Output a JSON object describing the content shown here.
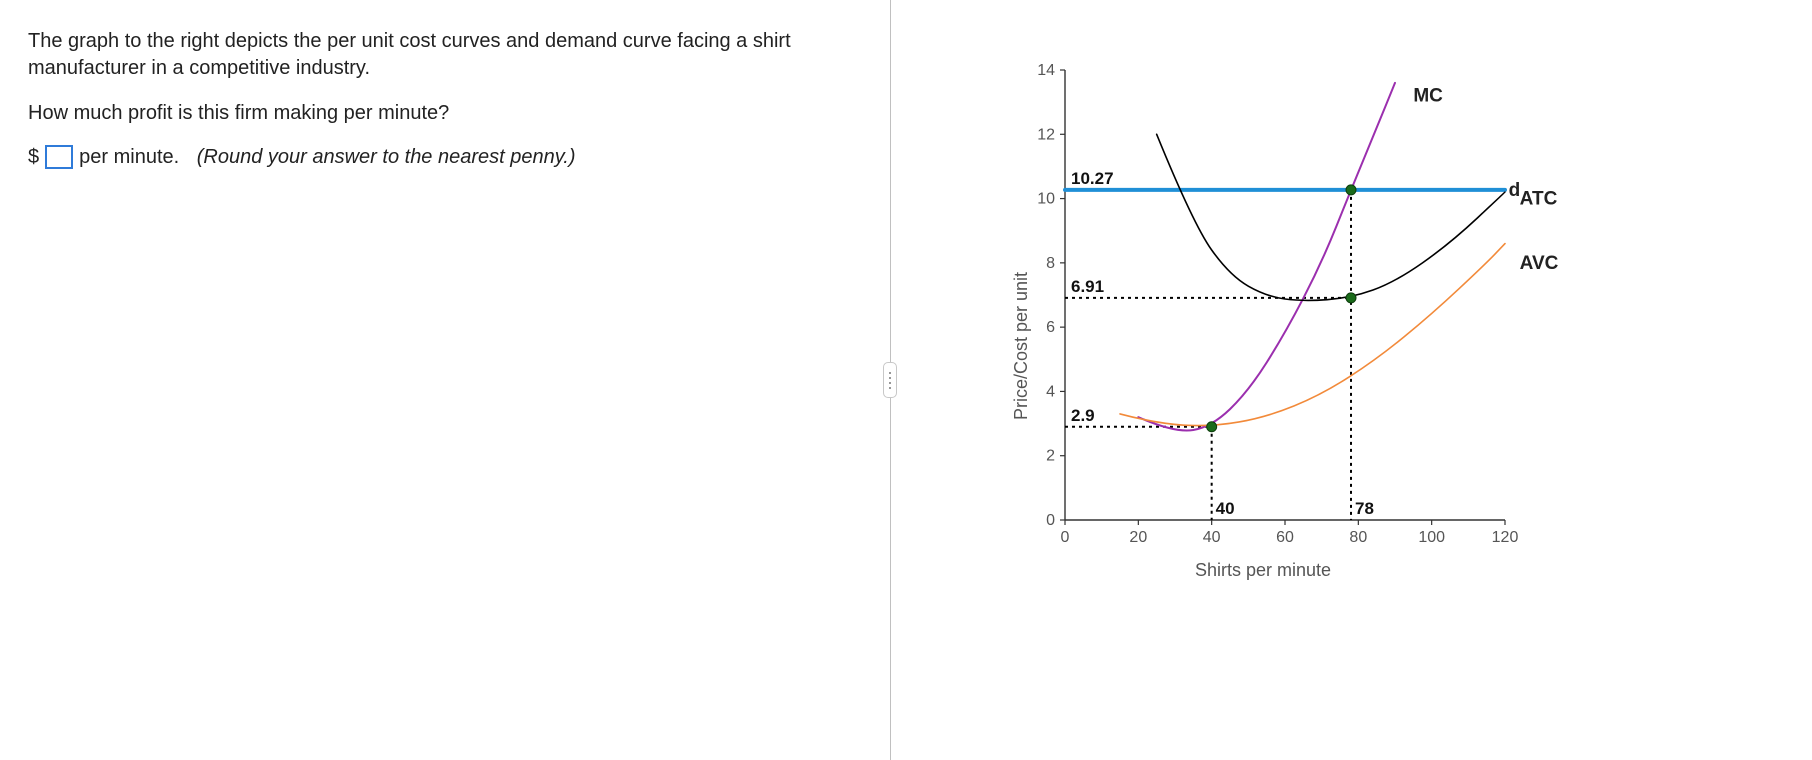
{
  "question": {
    "intro": "The graph to the right depicts the per unit cost curves and demand curve facing a shirt manufacturer in a competitive industry.",
    "prompt": "How much profit is this firm making per minute?",
    "currency_prefix": "$",
    "answer_value": "",
    "units_suffix": "per minute.",
    "hint": "(Round your answer to the nearest penny.)"
  },
  "chart_data": {
    "type": "line",
    "title": "",
    "xlabel": "Shirts per minute",
    "ylabel": "Price/Cost per unit",
    "xlim": [
      0,
      120
    ],
    "ylim": [
      0,
      14
    ],
    "x_ticks": [
      0,
      20,
      40,
      60,
      80,
      100,
      120
    ],
    "y_ticks": [
      0,
      2,
      4,
      6,
      8,
      10,
      12,
      14
    ],
    "series": [
      {
        "name": "d",
        "color": "#1f8fd6",
        "x": [
          0,
          120
        ],
        "y": [
          10.27,
          10.27
        ],
        "weight": 4
      },
      {
        "name": "MC",
        "color": "#9b2fae",
        "x": [
          20,
          30,
          40,
          50,
          60,
          70,
          78,
          85,
          90
        ],
        "y": [
          3.2,
          2.7,
          2.9,
          4.0,
          5.8,
          8.0,
          10.27,
          12.2,
          13.6
        ],
        "weight": 2
      },
      {
        "name": "ATC",
        "color": "#000000",
        "x": [
          25,
          35,
          45,
          55,
          65,
          78,
          90,
          105,
          120
        ],
        "y": [
          12.0,
          9.2,
          7.6,
          6.95,
          6.8,
          6.91,
          7.4,
          8.6,
          10.2
        ],
        "weight": 1.6
      },
      {
        "name": "AVC",
        "color": "#f28a3a",
        "x": [
          15,
          25,
          40,
          55,
          70,
          85,
          100,
          115,
          120
        ],
        "y": [
          3.3,
          3.0,
          2.9,
          3.2,
          3.9,
          5.0,
          6.4,
          8.0,
          8.6
        ],
        "weight": 1.6
      }
    ],
    "h_reference_lines": [
      {
        "y": 10.27,
        "label": "10.27",
        "to_x": 78
      },
      {
        "y": 6.91,
        "label": "6.91",
        "to_x": 78
      },
      {
        "y": 2.9,
        "label": "2.9",
        "to_x": 40
      }
    ],
    "v_reference_lines": [
      {
        "x": 40,
        "label": "40",
        "from_y": 2.9
      },
      {
        "x": 78,
        "label": "78",
        "from_y": 10.27
      }
    ],
    "points": [
      {
        "x": 40,
        "y": 2.9
      },
      {
        "x": 78,
        "y": 6.91
      },
      {
        "x": 78,
        "y": 10.27
      }
    ],
    "curve_label_positions": {
      "MC": {
        "x": 95,
        "y": 13.2
      },
      "d": {
        "x": 121,
        "y": 10.27
      },
      "ATC": {
        "x": 124,
        "y": 10.0
      },
      "AVC": {
        "x": 124,
        "y": 8.0
      }
    }
  }
}
